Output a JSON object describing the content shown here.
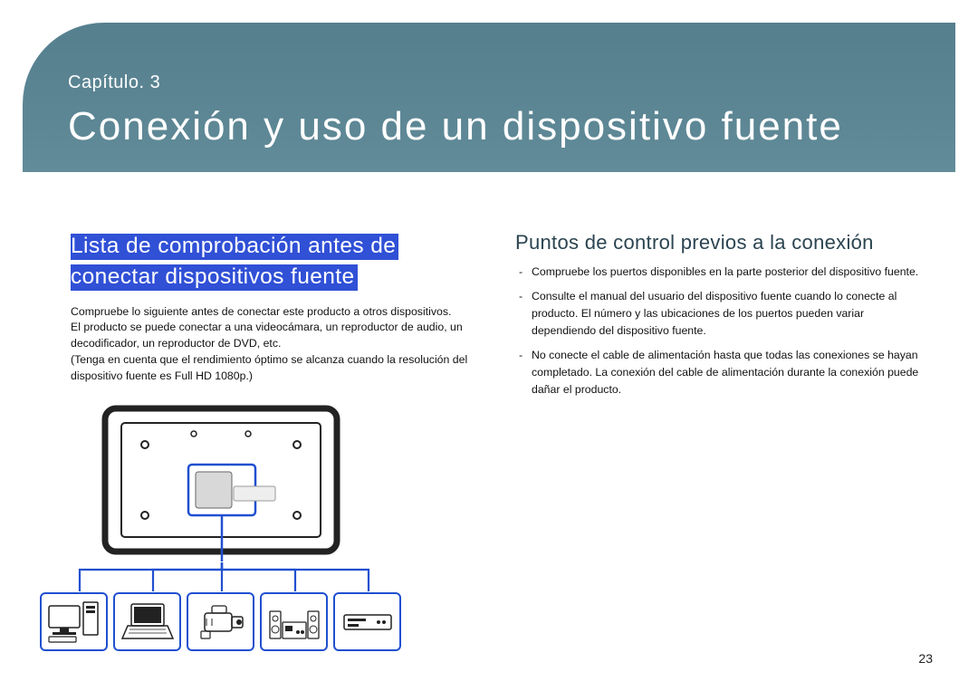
{
  "header": {
    "chapter": "Capítulo. 3",
    "title": "Conexión y uso de un dispositivo fuente"
  },
  "left": {
    "heading_line1": "Lista de comprobación antes de",
    "heading_line2": "conectar dispositivos fuente",
    "paragraph": "Compruebe lo siguiente antes de conectar este producto a otros dispositivos.\nEl producto se puede conectar a una videocámara, un reproductor de audio, un decodificador, un reproductor de DVD, etc.\n(Tenga en cuenta que el rendimiento óptimo se alcanza cuando la resolución del dispositivo fuente es Full HD 1080p.)"
  },
  "right": {
    "heading": "Puntos de control previos a la conexión",
    "bullets": [
      "Compruebe los puertos disponibles en la parte posterior del dispositivo fuente.",
      "Consulte el manual del usuario del dispositivo fuente cuando lo conecte al producto. El número y las ubicaciones de los puertos pueden variar dependiendo del dispositivo fuente.",
      "No conecte el cable de alimentación hasta que todas las conexiones se hayan completado. La conexión del cable de alimentación durante la conexión puede dañar el producto."
    ]
  },
  "page_number": "23",
  "accent_color": "#2050d0"
}
